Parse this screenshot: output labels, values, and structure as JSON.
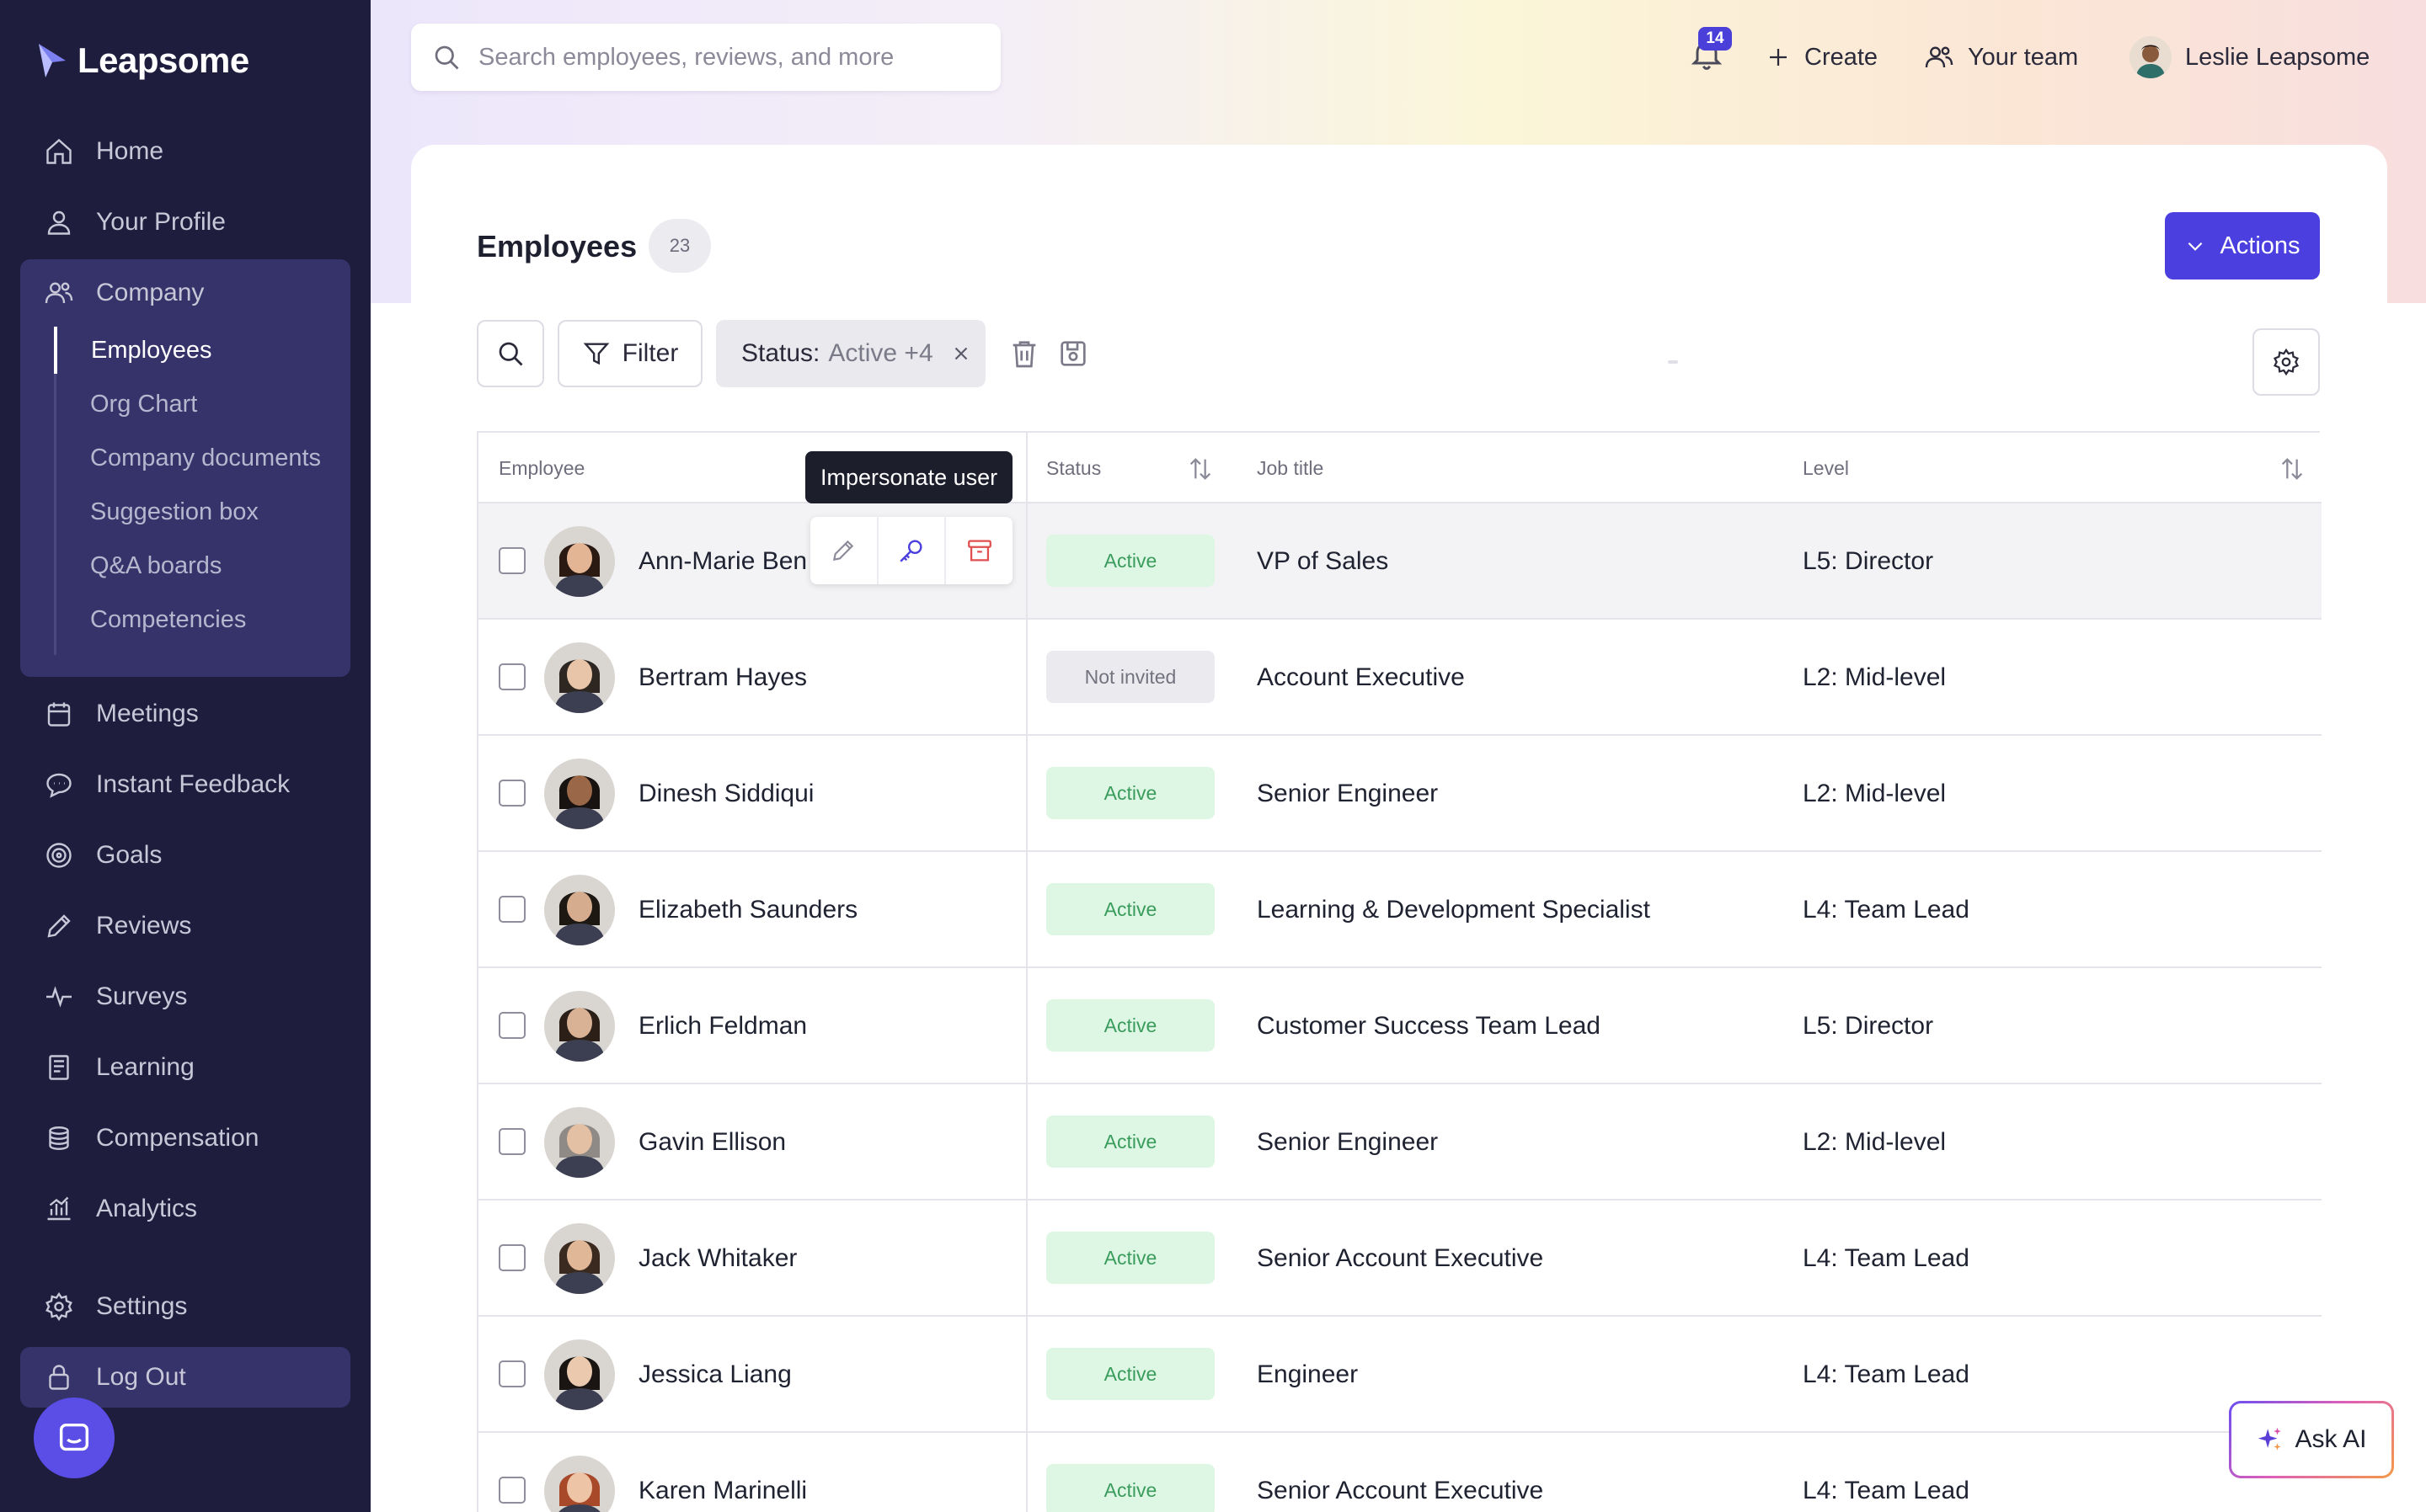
{
  "app": {
    "brand": "Leapsome",
    "colors": {
      "sidebar": "#1f1d3d",
      "accent": "#4b3fe0",
      "active_status": "#3a9c5c",
      "delete_icon": "#e04e4e"
    }
  },
  "sidebar": {
    "items": [
      {
        "label": "Home",
        "icon": "home-icon"
      },
      {
        "label": "Your Profile",
        "icon": "user-icon"
      },
      {
        "label": "Company",
        "icon": "users-icon"
      },
      {
        "label": "Meetings",
        "icon": "calendar-icon"
      },
      {
        "label": "Instant Feedback",
        "icon": "chat-icon"
      },
      {
        "label": "Goals",
        "icon": "target-icon"
      },
      {
        "label": "Reviews",
        "icon": "pencil-icon"
      },
      {
        "label": "Surveys",
        "icon": "pulse-icon"
      },
      {
        "label": "Learning",
        "icon": "book-icon"
      },
      {
        "label": "Compensation",
        "icon": "coins-icon"
      },
      {
        "label": "Analytics",
        "icon": "chart-icon"
      },
      {
        "label": "Settings",
        "icon": "gear-icon"
      },
      {
        "label": "Log Out",
        "icon": "lock-icon"
      }
    ],
    "company_subitems": [
      {
        "label": "Employees",
        "active": true
      },
      {
        "label": "Org Chart"
      },
      {
        "label": "Company documents"
      },
      {
        "label": "Suggestion box"
      },
      {
        "label": "Q&A boards"
      },
      {
        "label": "Competencies"
      }
    ]
  },
  "topbar": {
    "search_placeholder": "Search employees, reviews, and more",
    "notifications_count": "14",
    "create_label": "Create",
    "team_label": "Your team",
    "user_name": "Leslie Leapsome"
  },
  "page": {
    "title": "Employees",
    "count": "23",
    "actions_label": "Actions",
    "filter_label": "Filter",
    "status_filter_key": "Status:",
    "status_filter_value": "Active +4",
    "tooltip": "Impersonate user",
    "ask_ai_label": "Ask AI"
  },
  "table": {
    "headers": {
      "employee": "Employee",
      "status": "Status",
      "job": "Job title",
      "level": "Level"
    },
    "rows": [
      {
        "name": "Ann-Marie Ben",
        "status": "Active",
        "job": "VP of Sales",
        "level": "L5: Director",
        "skin": "#e4b595",
        "hair": "#2a1a12"
      },
      {
        "name": "Bertram Hayes",
        "status": "Not invited",
        "job": "Account Executive",
        "level": "L2: Mid-level",
        "skin": "#e8c4a8",
        "hair": "#2e2620"
      },
      {
        "name": "Dinesh Siddiqui",
        "status": "Active",
        "job": "Senior Engineer",
        "level": "L2: Mid-level",
        "skin": "#9a6848",
        "hair": "#181210"
      },
      {
        "name": "Elizabeth Saunders",
        "status": "Active",
        "job": "Learning & Development Specialist",
        "level": "L4: Team Lead",
        "skin": "#d6ac8e",
        "hair": "#1e1812"
      },
      {
        "name": "Erlich Feldman",
        "status": "Active",
        "job": "Customer Success Team Lead",
        "level": "L5: Director",
        "skin": "#d9b195",
        "hair": "#2b1f18"
      },
      {
        "name": "Gavin Ellison",
        "status": "Active",
        "job": "Senior Engineer",
        "level": "L2: Mid-level",
        "skin": "#e3bfa3",
        "hair": "#8f8a85"
      },
      {
        "name": "Jack Whitaker",
        "status": "Active",
        "job": "Senior Account Executive",
        "level": "L4: Team Lead",
        "skin": "#e0b898",
        "hair": "#3a2a20"
      },
      {
        "name": "Jessica Liang",
        "status": "Active",
        "job": "Engineer",
        "level": "L4: Team Lead",
        "skin": "#eac9ae",
        "hair": "#1a1512"
      },
      {
        "name": "Karen Marinelli",
        "status": "Active",
        "job": "Senior Account Executive",
        "level": "L4: Team Lead",
        "skin": "#eec4a6",
        "hair": "#a8492a"
      }
    ]
  }
}
